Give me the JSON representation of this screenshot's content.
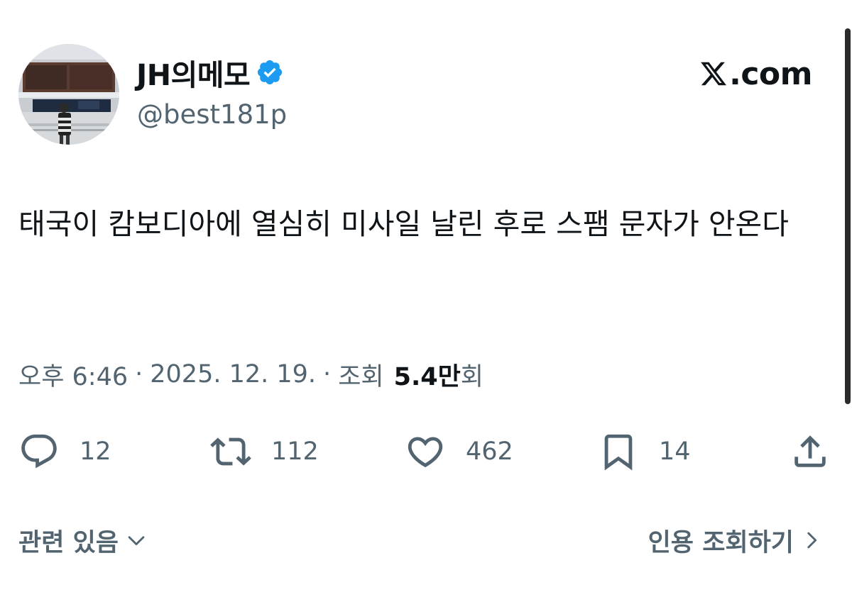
{
  "author": {
    "display_name": "JH의메모",
    "handle": "@best181p",
    "verified_icon": "verified-badge-icon"
  },
  "brand": {
    "text": ".com",
    "icon": "x-logo-icon"
  },
  "tweet": {
    "text": "태국이 캄보디아에 열심히 미사일 날린 후로 스팸 문자가 안온다"
  },
  "meta": {
    "time": "오후 6:46",
    "separator": "·",
    "date": "2025. 12. 19.",
    "views_label_prefix": "조회",
    "views_count": "5.4만",
    "views_label_suffix": "회"
  },
  "actions": {
    "reply": {
      "icon": "reply-icon",
      "count": "12"
    },
    "retweet": {
      "icon": "retweet-icon",
      "count": "112"
    },
    "like": {
      "icon": "heart-icon",
      "count": "462"
    },
    "bookmark": {
      "icon": "bookmark-icon",
      "count": "14"
    },
    "share": {
      "icon": "share-icon"
    }
  },
  "links": {
    "related": "관련 있음",
    "quotes": "인용 조회하기"
  },
  "colors": {
    "text_primary": "#0f1419",
    "text_secondary": "#536471",
    "verified_blue": "#1d9bf0"
  }
}
